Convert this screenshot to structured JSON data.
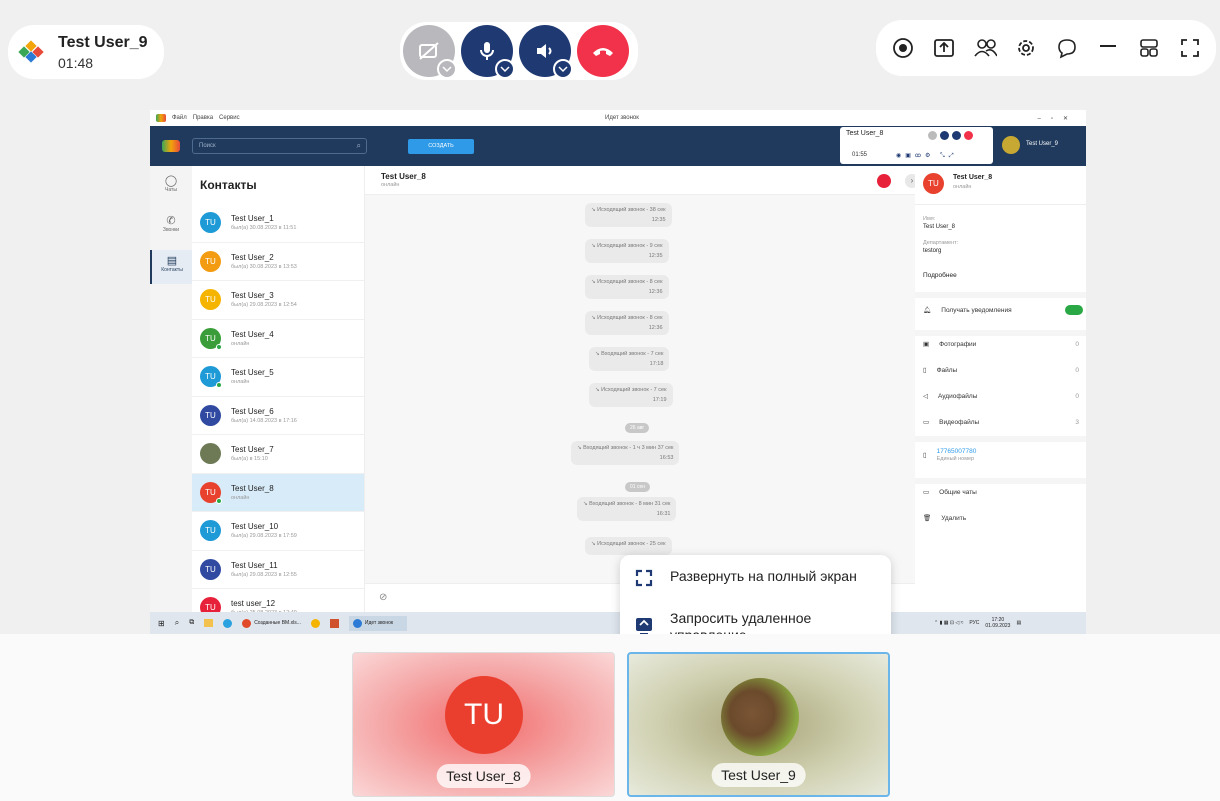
{
  "call_header": {
    "user_name": "Test User_9",
    "duration": "01:48"
  },
  "colors": {
    "accent": "#1f3a73",
    "hangup": "#f2324a",
    "video_off": "#b8b8bd",
    "app_bar": "#1f3a5c",
    "online": "#2aa845",
    "toggle": "#2aa845"
  },
  "call_controls": [
    {
      "name": "camera-off-button",
      "icon": "camera-off-icon"
    },
    {
      "name": "microphone-button",
      "icon": "microphone-icon"
    },
    {
      "name": "speaker-button",
      "icon": "speaker-icon"
    },
    {
      "name": "hangup-button",
      "icon": "phone-hangup-icon"
    }
  ],
  "top_right_icons": [
    "record-icon",
    "screen-share-icon",
    "participants-icon",
    "settings-icon",
    "chat-icon",
    "minimize-icon",
    "layout-icon",
    "fullscreen-icon"
  ],
  "shared_screen": {
    "menu": [
      "Файл",
      "Правка",
      "Сервис"
    ],
    "window_title": "Идет звонок",
    "search_placeholder": "Поиск",
    "create_button": "СОЗДАТЬ",
    "mini_call": {
      "name": "Test User_8",
      "timer": "01:55"
    },
    "account_name": "Test User_9",
    "rail": [
      {
        "label": "Чаты"
      },
      {
        "label": "Звонки"
      },
      {
        "label": "Контакты"
      }
    ],
    "contacts_title": "Контакты",
    "contacts": [
      {
        "name": "Test User_1",
        "status": "был(а) 30.08.2023 в 11:51",
        "color": "#1e9ad6",
        "initials": "TU"
      },
      {
        "name": "Test User_2",
        "status": "был(а) 30.08.2023 в 13:53",
        "color": "#f39c12",
        "initials": "TU"
      },
      {
        "name": "Test User_3",
        "status": "был(а) 29.08.2023 в 12:54",
        "color": "#f5b400",
        "initials": "TU"
      },
      {
        "name": "Test User_4",
        "status": "онлайн",
        "color": "#3a9d3a",
        "initials": "TU"
      },
      {
        "name": "Test User_5",
        "status": "онлайн",
        "color": "#1e9ad6",
        "initials": "TU"
      },
      {
        "name": "Test User_6",
        "status": "был(а) 14.08.2023 в 17:16",
        "color": "#2f4aa0",
        "initials": "TU"
      },
      {
        "name": "Test User_7",
        "status": "был(а) в 15:10",
        "color": "#6d7a55",
        "initials": ""
      },
      {
        "name": "Test User_8",
        "status": "онлайн",
        "color": "#e8412e",
        "initials": "TU"
      },
      {
        "name": "Test User_10",
        "status": "был(а) 29.08.2023 в 17:59",
        "color": "#1e9ad6",
        "initials": "TU"
      },
      {
        "name": "Test User_11",
        "status": "был(а) 29.08.2023 в 12:55",
        "color": "#2f4aa0",
        "initials": "TU"
      },
      {
        "name": "test user_12",
        "status": "был(а) 25.08.2023 в 12:49",
        "color": "#e8213a",
        "initials": "TU"
      }
    ],
    "chat_header": {
      "name": "Test User_8",
      "status": "онлайн"
    },
    "messages": [
      {
        "text": "Исходящий звонок - 38 сек",
        "time": "12:35"
      },
      {
        "text": "Исходящий звонок - 9 сек",
        "time": "12:35"
      },
      {
        "text": "Исходящий звонок - 8 сек",
        "time": "12:36"
      },
      {
        "text": "Исходящий звонок - 8 сек",
        "time": "12:36"
      },
      {
        "text": "Входящий звонок - 7 сек",
        "time": "17:18"
      },
      {
        "text": "Исходящий звонок - 7 сек",
        "time": "17:19"
      },
      {
        "text": "Входящий звонок - 1 ч 3 мин 37 сек",
        "time": "16:53"
      },
      {
        "text": "Входящий звонок - 8 мин 31 сек",
        "time": "16:31"
      },
      {
        "text": "Исходящий звонок - 25 сек",
        "time": ""
      }
    ],
    "date_pills": [
      "26 авг",
      "01 сен"
    ],
    "info": {
      "name": "Test User_8",
      "status": "онлайн",
      "name_label": "Имя:",
      "name_value": "Test User_8",
      "dept_label": "Департамент:",
      "dept_value": "testorg",
      "more": "Подробнее",
      "notify": "Получать уведомления",
      "media": [
        {
          "label": "Фотографии",
          "count": "0",
          "icon": "photo-icon"
        },
        {
          "label": "Файлы",
          "count": "0",
          "icon": "file-icon"
        },
        {
          "label": "Аудиофайлы",
          "count": "0",
          "icon": "audio-icon"
        },
        {
          "label": "Видеофайлы",
          "count": "3",
          "icon": "video-icon"
        }
      ],
      "phone": "17765007780",
      "phone_label": "Единый номер",
      "common_chats": "Общие чаты",
      "delete": "Удалить"
    },
    "taskbar": {
      "app1": "Созданные ВМ.xls...",
      "app2": "Идет звонок",
      "lang": "РУС",
      "time": "17:20",
      "date": "01.09.2023"
    }
  },
  "popup": {
    "fullscreen": "Развернуть на полный экран",
    "remote": "Запросить удаленное управление"
  },
  "tiles": [
    {
      "name": "Test User_8",
      "initials": "TU"
    },
    {
      "name": "Test User_9"
    }
  ]
}
